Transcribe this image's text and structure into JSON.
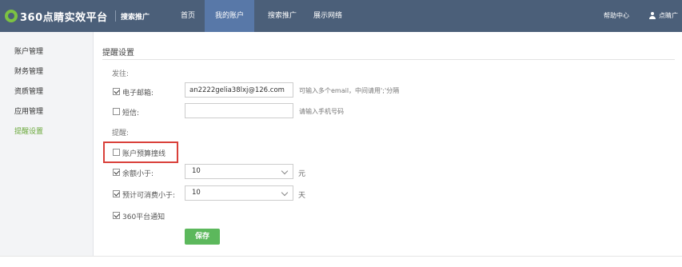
{
  "brand": {
    "name": "360点睛实效平台",
    "product": "搜索推广"
  },
  "nav": {
    "items": [
      {
        "label": "首页"
      },
      {
        "label": "我的账户"
      },
      {
        "label": "搜索推广"
      },
      {
        "label": "展示网络"
      }
    ],
    "active": "我的账户",
    "help": "帮助中心",
    "user": "点睛广告"
  },
  "sidebar": {
    "items": [
      {
        "label": "账户管理"
      },
      {
        "label": "财务管理"
      },
      {
        "label": "资质管理"
      },
      {
        "label": "应用管理"
      },
      {
        "label": "提醒设置"
      }
    ],
    "active": "提醒设置"
  },
  "main": {
    "title": "提醒设置",
    "send_to_label": "发往:",
    "email": {
      "label": "电子邮箱:",
      "checked": true,
      "value": "an2222gelia38lxj@126.com",
      "hint": "可输入多个email，中间请用';'分隔"
    },
    "sms": {
      "label": "短信:",
      "checked": false,
      "value": "",
      "hint": "请输入手机号码"
    },
    "remind_label": "提醒:",
    "budget": {
      "label": "账户预算撞线",
      "checked": false
    },
    "balance": {
      "label": "余额小于:",
      "checked": true,
      "value": "10",
      "unit": "元"
    },
    "days": {
      "label": "预计可消费小于:",
      "checked": true,
      "value": "10",
      "unit": "天"
    },
    "platform": {
      "label": "360平台通知",
      "checked": true
    },
    "save_label": "保存"
  },
  "colors": {
    "topbar": "#4b5f79",
    "nav_active": "#5878a8",
    "accent_green": "#5cb85c",
    "highlight_red": "#d9403a"
  }
}
